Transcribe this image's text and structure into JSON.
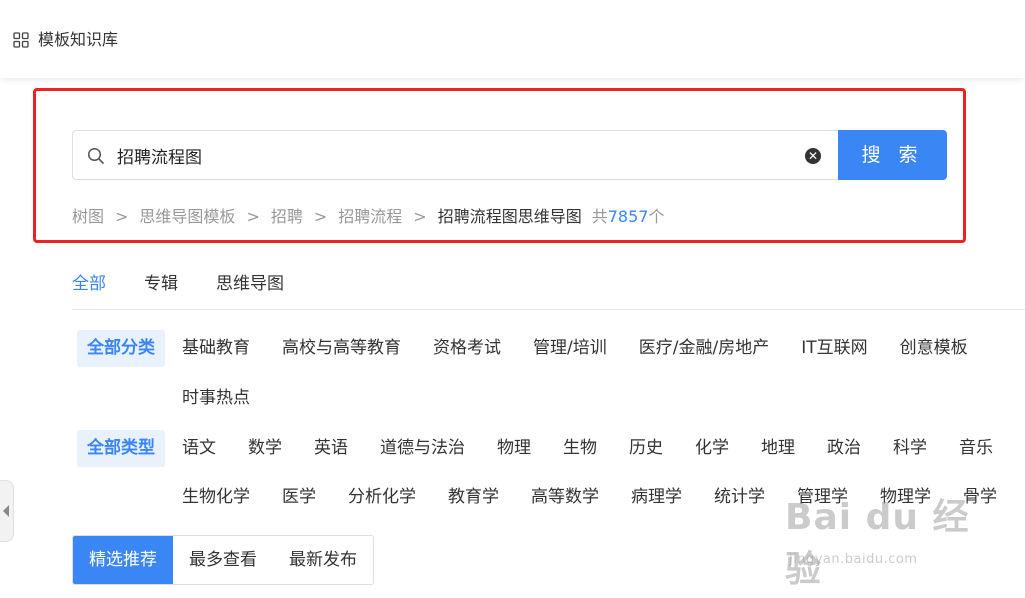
{
  "header": {
    "title": "模板知识库",
    "icon": "grid-icon"
  },
  "search": {
    "query": "招聘流程图",
    "button_label": "搜 索",
    "icons": [
      "search-icon",
      "clear-icon"
    ]
  },
  "breadcrumb": {
    "items": [
      "树图",
      "思维导图模板",
      "招聘",
      "招聘流程"
    ],
    "current": "招聘流程图思维导图",
    "count_prefix": "共",
    "count_number": "7857",
    "count_suffix": "个"
  },
  "tabs": [
    "全部",
    "专辑",
    "思维导图"
  ],
  "active_tab": "全部",
  "categories": {
    "label": "全部分类",
    "row1": [
      "基础教育",
      "高校与高等教育",
      "资格考试",
      "管理/培训",
      "医疗/金融/房地产",
      "IT互联网",
      "创意模板"
    ],
    "row2": [
      "时事热点"
    ]
  },
  "types": {
    "label": "全部类型",
    "row1": [
      "语文",
      "数学",
      "英语",
      "道德与法治",
      "物理",
      "生物",
      "历史",
      "化学",
      "地理",
      "政治",
      "科学",
      "音乐"
    ],
    "row2": [
      "生物化学",
      "医学",
      "分析化学",
      "教育学",
      "高等数学",
      "病理学",
      "统计学",
      "管理学",
      "物理学",
      "骨学"
    ]
  },
  "sort": {
    "options": [
      "精选推荐",
      "最多查看",
      "最新发布"
    ],
    "active": "精选推荐"
  },
  "watermark": {
    "brand": "Bai du 经验",
    "url": "jingyan.baidu.com"
  },
  "colors": {
    "accent": "#3a86f5",
    "highlight_border": "#ee2222"
  }
}
